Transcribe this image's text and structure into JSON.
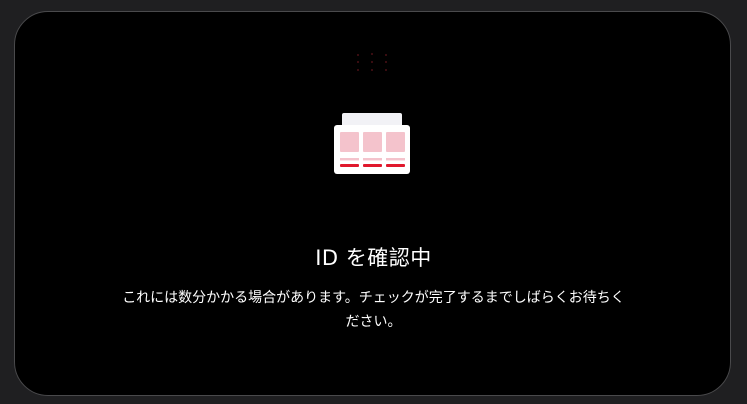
{
  "dialog": {
    "title": "ID を確認中",
    "description": "これには数分かかる場合があります。チェックが完了するまでしばらくお待ちください。",
    "illustration_icon": "id-card-icon",
    "loading_icon": "loading-dots-icon"
  },
  "colors": {
    "background": "#1f1f21",
    "card": "#000000",
    "accent": "#e0182d",
    "tile": "#f4c3cc"
  }
}
